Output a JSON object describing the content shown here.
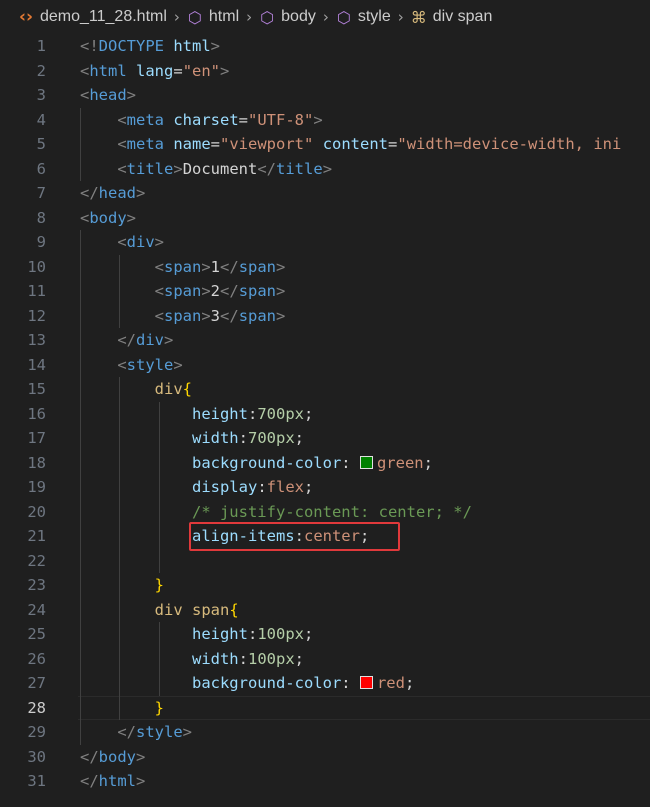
{
  "breadcrumb": [
    {
      "label": "demo_11_28.html",
      "icon": "code-file-icon"
    },
    {
      "label": "html",
      "icon": "cube-icon"
    },
    {
      "label": "body",
      "icon": "cube-icon"
    },
    {
      "label": "style",
      "icon": "cube-icon"
    },
    {
      "label": "div span",
      "icon": "css-selector-icon"
    }
  ],
  "editor": {
    "active_line": 28,
    "colors": {
      "background": "#1f1f1f",
      "tag": "#569cd6",
      "attribute": "#9cdcfe",
      "string": "#ce9178",
      "selector": "#d7ba7d",
      "number": "#b5cea8",
      "comment": "#6a9955",
      "highlight_box": "#e0393b",
      "swatch_green": "#008000",
      "swatch_red": "#ff0000"
    },
    "lines": [
      {
        "n": "1",
        "tokens": [
          [
            "br",
            "<!"
          ],
          [
            "tag",
            "DOCTYPE"
          ],
          [
            "txt",
            " "
          ],
          [
            "attr",
            "html"
          ],
          [
            "br",
            ">"
          ]
        ]
      },
      {
        "n": "2",
        "tokens": [
          [
            "br",
            "<"
          ],
          [
            "tag",
            "html"
          ],
          [
            "txt",
            " "
          ],
          [
            "attr",
            "lang"
          ],
          [
            "txt",
            "="
          ],
          [
            "str",
            "\"en\""
          ],
          [
            "br",
            ">"
          ]
        ]
      },
      {
        "n": "3",
        "tokens": [
          [
            "br",
            "<"
          ],
          [
            "tag",
            "head"
          ],
          [
            "br",
            ">"
          ]
        ]
      },
      {
        "n": "4",
        "tokens": [
          [
            "txt",
            "    "
          ],
          [
            "br",
            "<"
          ],
          [
            "tag",
            "meta"
          ],
          [
            "txt",
            " "
          ],
          [
            "attr",
            "charset"
          ],
          [
            "txt",
            "="
          ],
          [
            "str",
            "\"UTF-8\""
          ],
          [
            "br",
            ">"
          ]
        ]
      },
      {
        "n": "5",
        "tokens": [
          [
            "txt",
            "    "
          ],
          [
            "br",
            "<"
          ],
          [
            "tag",
            "meta"
          ],
          [
            "txt",
            " "
          ],
          [
            "attr",
            "name"
          ],
          [
            "txt",
            "="
          ],
          [
            "str",
            "\"viewport\""
          ],
          [
            "txt",
            " "
          ],
          [
            "attr",
            "content"
          ],
          [
            "txt",
            "="
          ],
          [
            "str",
            "\"width=device-width, ini"
          ]
        ]
      },
      {
        "n": "6",
        "tokens": [
          [
            "txt",
            "    "
          ],
          [
            "br",
            "<"
          ],
          [
            "tag",
            "title"
          ],
          [
            "br",
            ">"
          ],
          [
            "txt",
            "Document"
          ],
          [
            "br",
            "</"
          ],
          [
            "tag",
            "title"
          ],
          [
            "br",
            ">"
          ]
        ]
      },
      {
        "n": "7",
        "tokens": [
          [
            "br",
            "</"
          ],
          [
            "tag",
            "head"
          ],
          [
            "br",
            ">"
          ]
        ]
      },
      {
        "n": "8",
        "tokens": [
          [
            "br",
            "<"
          ],
          [
            "tag",
            "body"
          ],
          [
            "br",
            ">"
          ]
        ]
      },
      {
        "n": "9",
        "tokens": [
          [
            "txt",
            "    "
          ],
          [
            "br",
            "<"
          ],
          [
            "tag",
            "div"
          ],
          [
            "br",
            ">"
          ]
        ]
      },
      {
        "n": "10",
        "tokens": [
          [
            "txt",
            "        "
          ],
          [
            "br",
            "<"
          ],
          [
            "tag",
            "span"
          ],
          [
            "br",
            ">"
          ],
          [
            "txt",
            "1"
          ],
          [
            "br",
            "</"
          ],
          [
            "tag",
            "span"
          ],
          [
            "br",
            ">"
          ]
        ]
      },
      {
        "n": "11",
        "tokens": [
          [
            "txt",
            "        "
          ],
          [
            "br",
            "<"
          ],
          [
            "tag",
            "span"
          ],
          [
            "br",
            ">"
          ],
          [
            "txt",
            "2"
          ],
          [
            "br",
            "</"
          ],
          [
            "tag",
            "span"
          ],
          [
            "br",
            ">"
          ]
        ]
      },
      {
        "n": "12",
        "tokens": [
          [
            "txt",
            "        "
          ],
          [
            "br",
            "<"
          ],
          [
            "tag",
            "span"
          ],
          [
            "br",
            ">"
          ],
          [
            "txt",
            "3"
          ],
          [
            "br",
            "</"
          ],
          [
            "tag",
            "span"
          ],
          [
            "br",
            ">"
          ]
        ]
      },
      {
        "n": "13",
        "tokens": [
          [
            "txt",
            "    "
          ],
          [
            "br",
            "</"
          ],
          [
            "tag",
            "div"
          ],
          [
            "br",
            ">"
          ]
        ]
      },
      {
        "n": "14",
        "tokens": [
          [
            "txt",
            "    "
          ],
          [
            "br",
            "<"
          ],
          [
            "tag",
            "style"
          ],
          [
            "br",
            ">"
          ]
        ]
      },
      {
        "n": "15",
        "tokens": [
          [
            "txt",
            "        "
          ],
          [
            "sel",
            "div"
          ],
          [
            "brace",
            "{"
          ]
        ]
      },
      {
        "n": "16",
        "tokens": [
          [
            "txt",
            "            "
          ],
          [
            "prop",
            "height"
          ],
          [
            "txt",
            ":"
          ],
          [
            "num",
            "700px"
          ],
          [
            "txt",
            ";"
          ]
        ]
      },
      {
        "n": "17",
        "tokens": [
          [
            "txt",
            "            "
          ],
          [
            "prop",
            "width"
          ],
          [
            "txt",
            ":"
          ],
          [
            "num",
            "700px"
          ],
          [
            "txt",
            ";"
          ]
        ]
      },
      {
        "n": "18",
        "tokens": [
          [
            "txt",
            "            "
          ],
          [
            "prop",
            "background-color"
          ],
          [
            "txt",
            ": "
          ],
          [
            "swatch",
            "green"
          ],
          [
            "val",
            "green"
          ],
          [
            "txt",
            ";"
          ]
        ]
      },
      {
        "n": "19",
        "tokens": [
          [
            "txt",
            "            "
          ],
          [
            "prop",
            "display"
          ],
          [
            "txt",
            ":"
          ],
          [
            "val",
            "flex"
          ],
          [
            "txt",
            ";"
          ]
        ]
      },
      {
        "n": "20",
        "tokens": [
          [
            "txt",
            "            "
          ],
          [
            "com",
            "/* justify-content: center; */"
          ]
        ]
      },
      {
        "n": "21",
        "tokens": [
          [
            "txt",
            "            "
          ],
          [
            "prop",
            "align-items"
          ],
          [
            "txt",
            ":"
          ],
          [
            "val",
            "center"
          ],
          [
            "txt",
            ";"
          ]
        ]
      },
      {
        "n": "22",
        "tokens": []
      },
      {
        "n": "23",
        "tokens": [
          [
            "txt",
            "        "
          ],
          [
            "brace",
            "}"
          ]
        ]
      },
      {
        "n": "24",
        "tokens": [
          [
            "txt",
            "        "
          ],
          [
            "sel",
            "div span"
          ],
          [
            "brace",
            "{"
          ]
        ]
      },
      {
        "n": "25",
        "tokens": [
          [
            "txt",
            "            "
          ],
          [
            "prop",
            "height"
          ],
          [
            "txt",
            ":"
          ],
          [
            "num",
            "100px"
          ],
          [
            "txt",
            ";"
          ]
        ]
      },
      {
        "n": "26",
        "tokens": [
          [
            "txt",
            "            "
          ],
          [
            "prop",
            "width"
          ],
          [
            "txt",
            ":"
          ],
          [
            "num",
            "100px"
          ],
          [
            "txt",
            ";"
          ]
        ]
      },
      {
        "n": "27",
        "tokens": [
          [
            "txt",
            "            "
          ],
          [
            "prop",
            "background-color"
          ],
          [
            "txt",
            ": "
          ],
          [
            "swatch",
            "red"
          ],
          [
            "val",
            "red"
          ],
          [
            "txt",
            ";"
          ]
        ]
      },
      {
        "n": "28",
        "tokens": [
          [
            "txt",
            "        "
          ],
          [
            "brace",
            "}"
          ]
        ]
      },
      {
        "n": "29",
        "tokens": [
          [
            "txt",
            "    "
          ],
          [
            "br",
            "</"
          ],
          [
            "tag",
            "style"
          ],
          [
            "br",
            ">"
          ]
        ]
      },
      {
        "n": "30",
        "tokens": [
          [
            "br",
            "</"
          ],
          [
            "tag",
            "body"
          ],
          [
            "br",
            ">"
          ]
        ]
      },
      {
        "n": "31",
        "tokens": [
          [
            "br",
            "</"
          ],
          [
            "tag",
            "html"
          ],
          [
            "br",
            ">"
          ]
        ]
      }
    ]
  }
}
